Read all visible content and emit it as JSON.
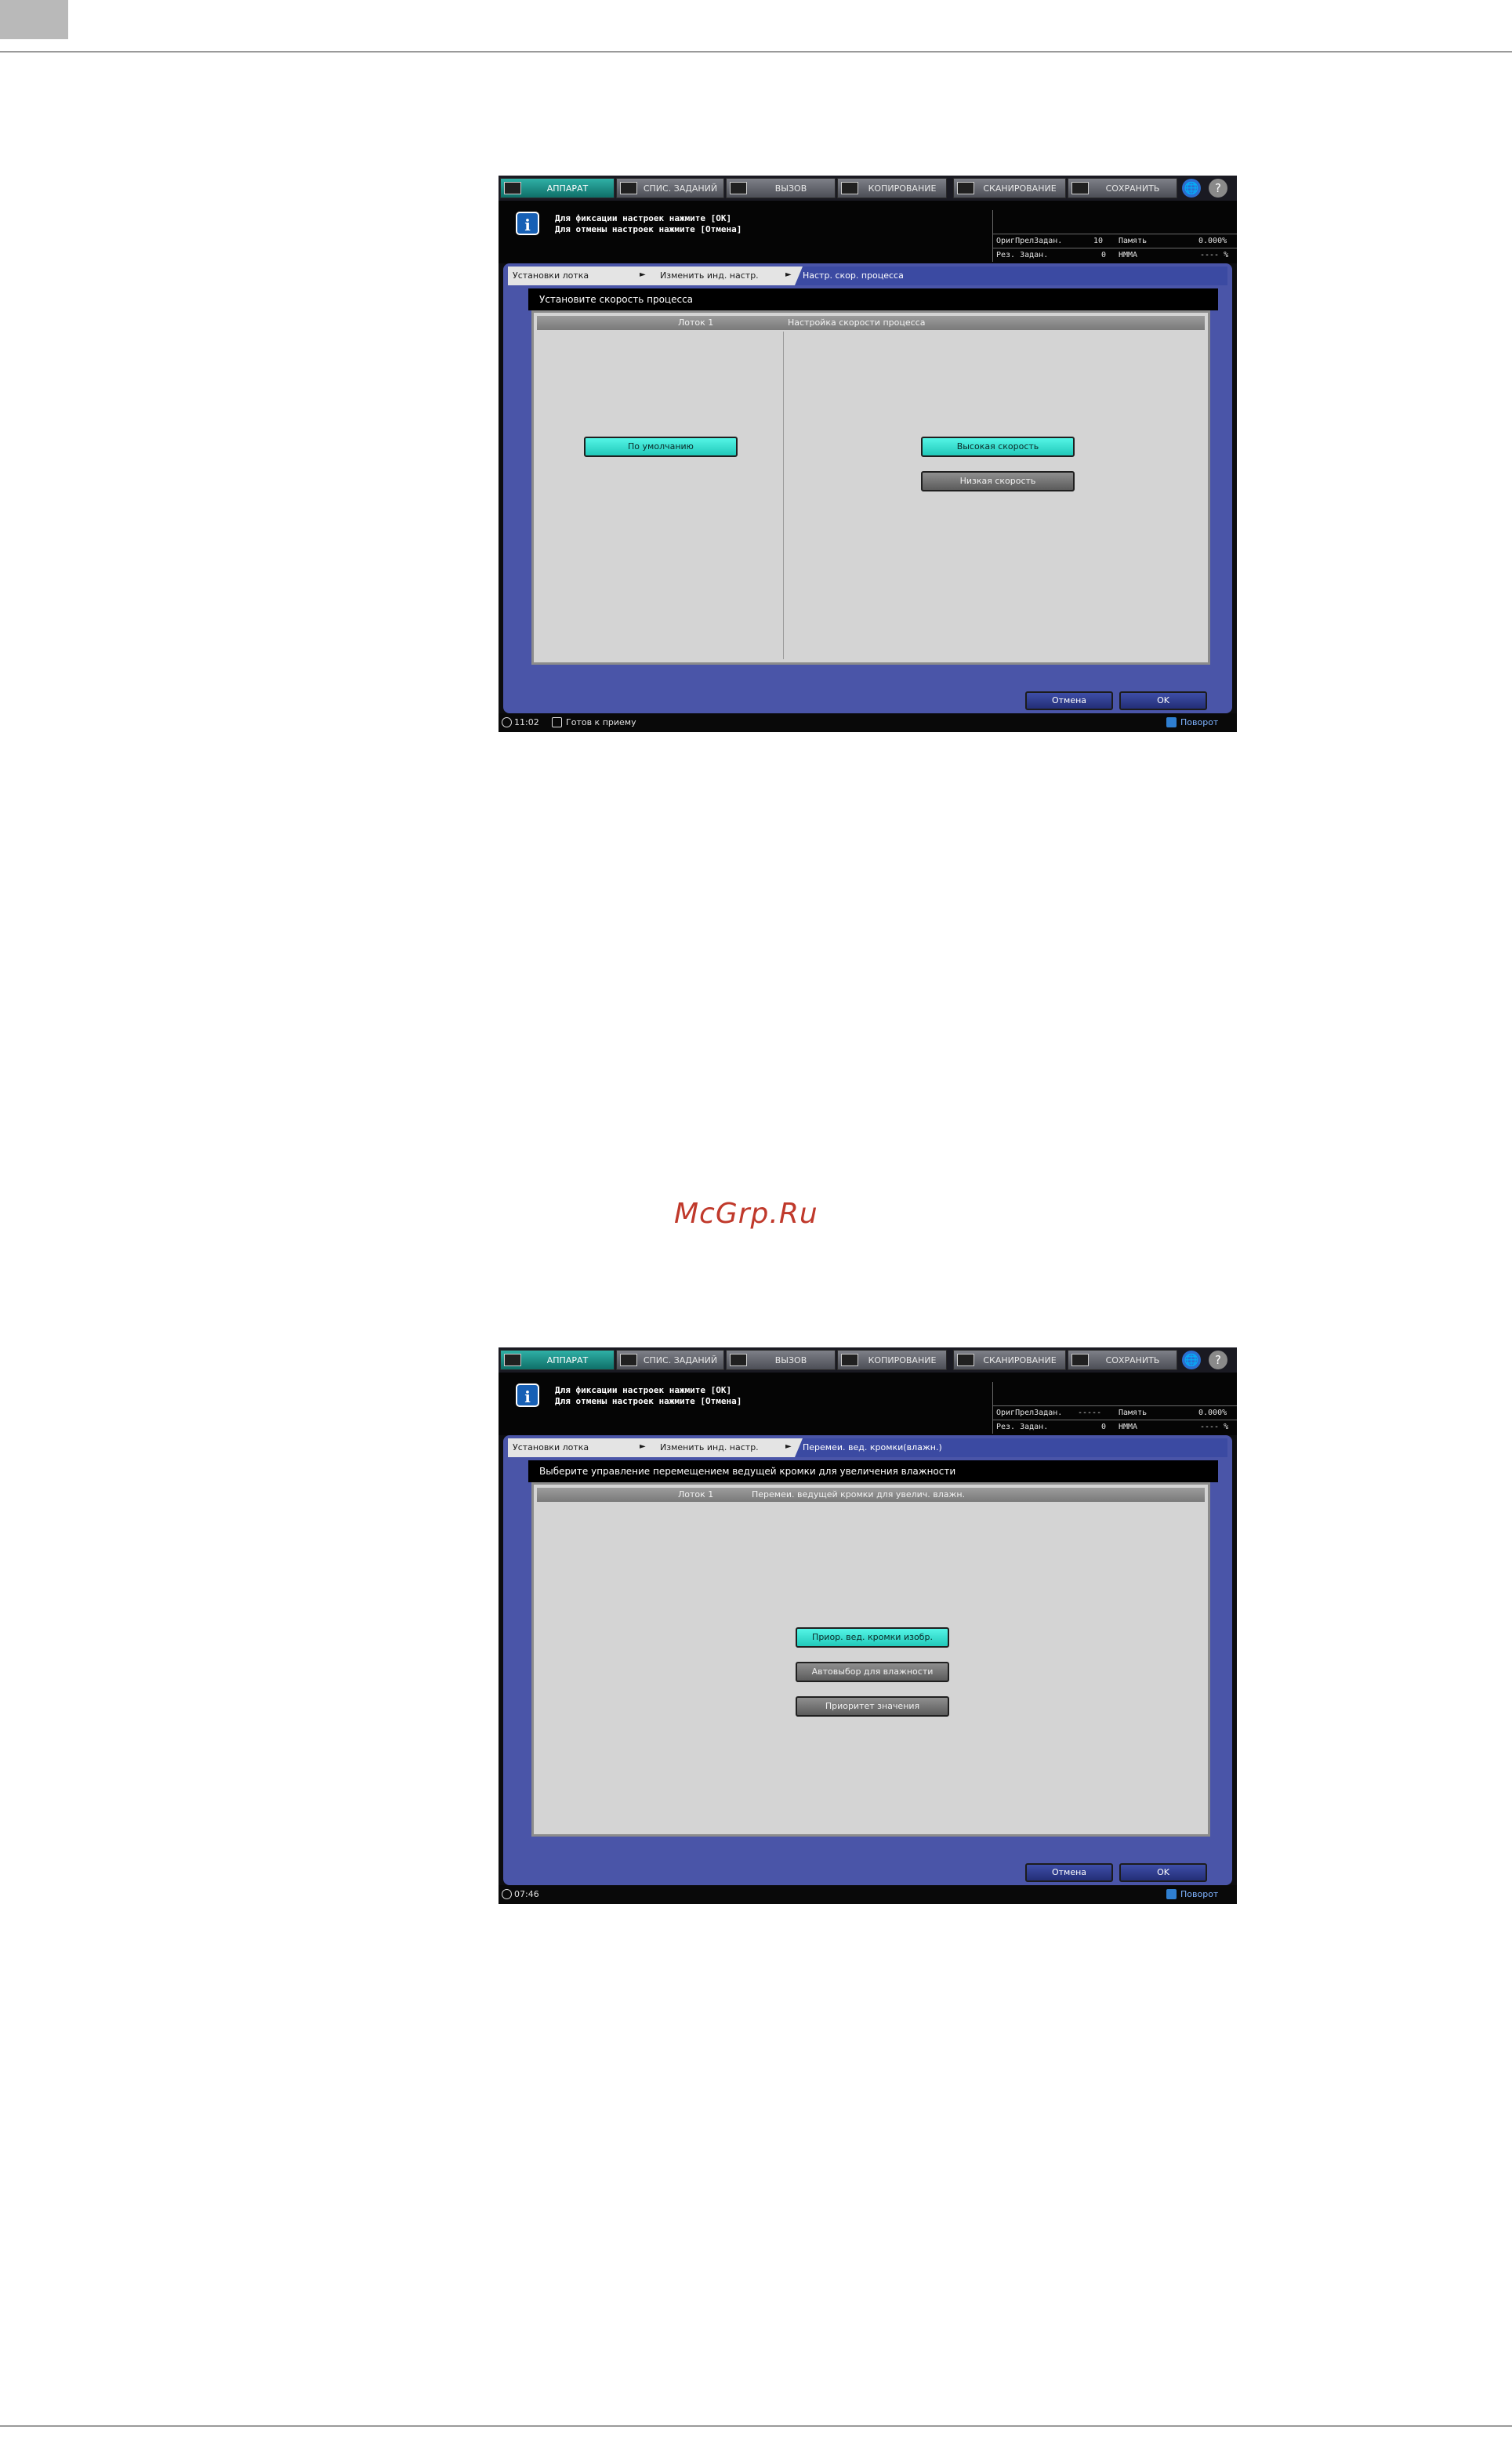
{
  "page": {
    "watermark": "McGrp.Ru"
  },
  "shared": {
    "tabs": [
      "АППАРАТ",
      "СПИС. ЗАДАНИЙ",
      "ВЫЗОВ",
      "КОПИРОВАНИЕ",
      "СКАНИРОВАНИЕ",
      "СОХРАНИТЬ"
    ],
    "globe_glyph": "🌐",
    "help_glyph": "?",
    "info_glyph": "i",
    "message_line1": "Для фиксации настроек нажмите [OK]",
    "message_line2": "Для отмены настроек нажмите [Отмена]",
    "stat_mem_label": "Память",
    "stat_mem_value": "0.000%",
    "stat_res_label": "Рез. Задан.",
    "stat_res_value": "0",
    "stat_hdd_label": "HMMA",
    "stat_hdd_value": "---- %",
    "breadcrumb1": "Установки лотка",
    "breadcrumb2": "Изменить инд. настр.",
    "arrow": "►",
    "cancel_label": "Отмена",
    "ok_label": "OK",
    "rotate_label": "Поворот"
  },
  "screen1": {
    "stat_job_label": "ОригПрелЗадан.",
    "stat_job_value": "10",
    "breadcrumb3": "Настр. скор. процесса",
    "instruction": "Установите скорость процесса",
    "header_left": "Лоток 1",
    "header_right": "Настройка скорости процесса",
    "btn_default": "По умолчанию",
    "btn_high": "Высокая скорость",
    "btn_low": "Низкая скорость",
    "time": "11:02",
    "status": "Готов к приему"
  },
  "screen2": {
    "stat_job_label": "ОригПрелЗадан.",
    "stat_job_value": "-----",
    "breadcrumb3": "Перемеи. вед. кромки(влажн.)",
    "instruction": "Выберите управление перемещением ведущей кромки для увеличения влажности",
    "header_left": "Лоток 1",
    "header_right": "Перемеи. ведущей кромки для увелич. влажн.",
    "btn_opt1": "Приор. вед. кромки изобр.",
    "btn_opt2": "Автовыбор для влажности",
    "btn_opt3": "Приоритет значения",
    "time": "07:46"
  },
  "colors": {
    "selected_button": "#2fe3d3",
    "panel_blue": "#4a55a8",
    "active_tab": "#1f9e94"
  }
}
